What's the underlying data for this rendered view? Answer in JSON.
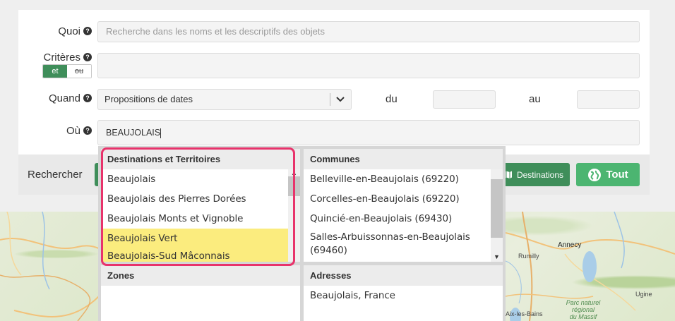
{
  "form": {
    "quoi": {
      "label": "Quoi",
      "placeholder": "Recherche dans les noms et les descriptifs des objets"
    },
    "criteres": {
      "label": "Critères",
      "toggle_on": "et",
      "toggle_off": "ou"
    },
    "quand": {
      "label": "Quand",
      "select_value": "Propositions de dates",
      "du_label": "du",
      "au_label": "au"
    },
    "ou": {
      "label": "Où",
      "value": "BEAUJOLAIS"
    },
    "help_glyph": "?"
  },
  "footer": {
    "rechercher_label": "Rechercher",
    "destinations_button": "Destinations",
    "tout_button": "Tout"
  },
  "dropdown": {
    "destinations": {
      "header": "Destinations et Territoires",
      "items": [
        "Beaujolais",
        "Beaujolais des Pierres Dorées",
        "Beaujolais Monts et Vignoble",
        "Beaujolais Vert",
        "Beaujolais-Sud Mâconnais"
      ]
    },
    "communes": {
      "header": "Communes",
      "items": [
        "Belleville-en-Beaujolais (69220)",
        "Corcelles-en-Beaujolais (69220)",
        "Quincié-en-Beaujolais (69430)",
        "Salles-Arbuissonnas-en-Beaujolais",
        "(69460)"
      ]
    },
    "zones": {
      "header": "Zones",
      "items": []
    },
    "adresses": {
      "header": "Adresses",
      "items": [
        "Beaujolais, France"
      ]
    }
  },
  "map": {
    "labels": [
      "Annecy",
      "Rumilly",
      "Ugine",
      "Aix-les-Bains",
      "Parc naturel",
      "régional",
      "du Massif"
    ]
  },
  "colors": {
    "accent_green": "#3f8e5a",
    "button_green": "#4cb571",
    "highlight": "#fbec7e",
    "focus_ring": "#e8336b"
  }
}
